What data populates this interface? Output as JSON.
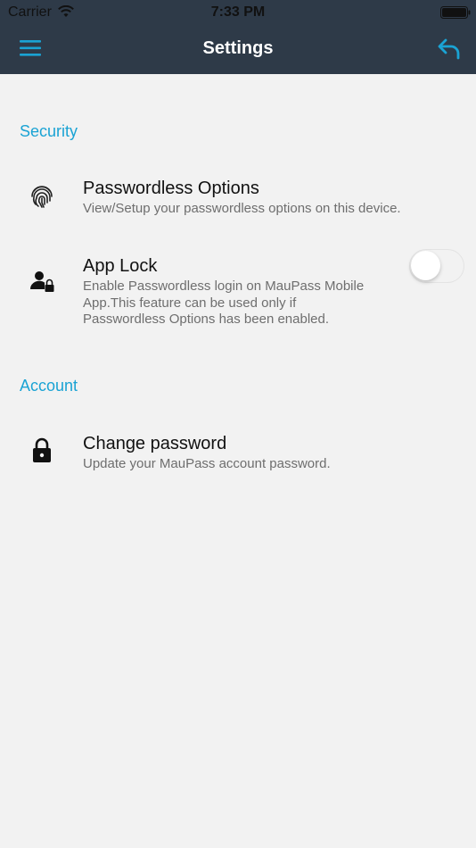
{
  "status_bar": {
    "carrier": "Carrier",
    "time": "7:33 PM",
    "wifi_icon": "wifi-icon",
    "battery_icon": "battery-full-icon"
  },
  "navbar": {
    "title": "Settings",
    "menu_icon": "hamburger-menu-icon",
    "back_icon": "reply-arrow-icon",
    "background": "#2e3a48",
    "icon_color": "#1aa3d4"
  },
  "sections": [
    {
      "header": "Security",
      "items": [
        {
          "icon": "fingerprint-icon",
          "title": "Passwordless Options",
          "subtitle": "View/Setup your passwordless options on this device."
        },
        {
          "icon": "user-lock-icon",
          "title": "App Lock",
          "subtitle_lines": [
            "Enable Passwordless login on MauPass Mobile",
            "App.This feature can be used only if",
            "Passwordless Options has been enabled."
          ],
          "toggle_on": false
        }
      ]
    },
    {
      "header": "Account",
      "items": [
        {
          "icon": "lock-icon",
          "title": "Change password",
          "subtitle": "Update your MauPass account password."
        }
      ]
    }
  ],
  "accent_color": "#1aa3d4",
  "background_color": "#f2f2f2"
}
